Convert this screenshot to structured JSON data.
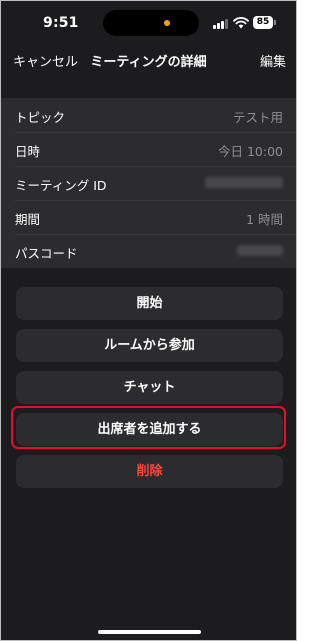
{
  "status_bar": {
    "time": "9:51",
    "battery": "85",
    "island_dot_color": "#ff9f0a"
  },
  "nav": {
    "cancel": "キャンセル",
    "title": "ミーティングの詳細",
    "edit": "編集"
  },
  "details": {
    "rows": [
      {
        "label": "トピック",
        "value": "テスト用"
      },
      {
        "label": "日時",
        "value": "今日 10:00"
      },
      {
        "label": "ミーティング ID",
        "value": ""
      },
      {
        "label": "期間",
        "value": "1 時間"
      },
      {
        "label": "パスコード",
        "value": ""
      }
    ]
  },
  "actions": {
    "start": "開始",
    "join_from_room": "ルームから参加",
    "chat": "チャット",
    "add_attendees": "出席者を追加する",
    "delete": "削除"
  },
  "colors": {
    "background": "#1c1c1e",
    "cell": "#2c2c2e",
    "danger": "#ff453a",
    "highlight": "#e0102a"
  }
}
